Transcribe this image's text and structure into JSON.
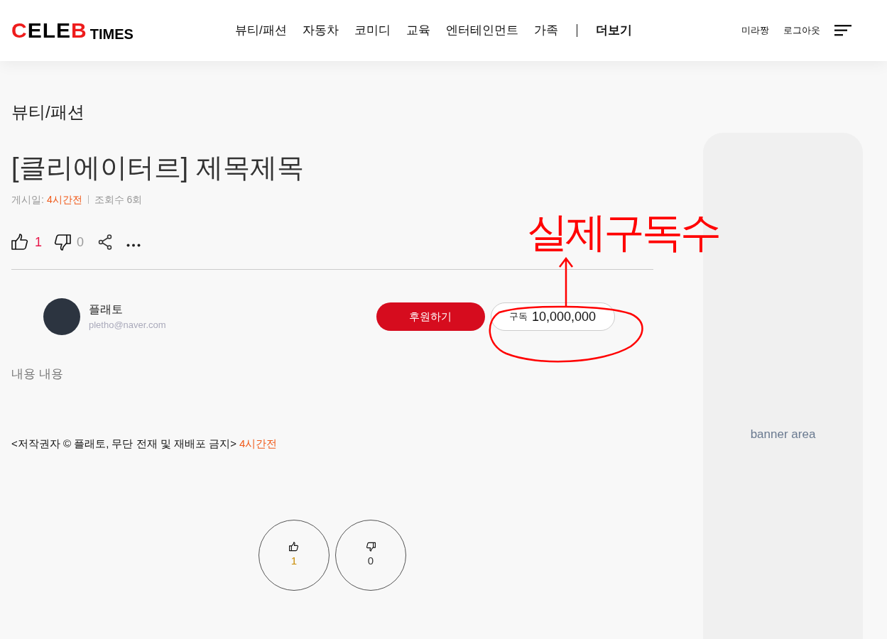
{
  "header": {
    "logo": {
      "text": "CELEB",
      "sub": "TIMES"
    },
    "nav": [
      {
        "label": "뷰티/패션",
        "kind": "link"
      },
      {
        "label": "자동차",
        "kind": "link"
      },
      {
        "label": "코미디",
        "kind": "link"
      },
      {
        "label": "교육",
        "kind": "link"
      },
      {
        "label": "엔터테인먼트",
        "kind": "link"
      },
      {
        "label": "가족",
        "kind": "link"
      },
      {
        "label": "더보기",
        "kind": "more"
      }
    ],
    "user": "미라짱",
    "logout": "로그아웃"
  },
  "category": "뷰티/패션",
  "article": {
    "title": "[클리에이터르] 제목제목",
    "meta": {
      "posted_label": "게시일:",
      "posted_time": "4시간전",
      "views": "조회수 6회"
    },
    "actions": {
      "likes": "1",
      "dislikes": "0"
    },
    "author": {
      "name": "플래토",
      "email": "pletho@naver.com"
    },
    "donate_button": "후원하기",
    "subscribe": {
      "label": "구독",
      "count": "10,000,000"
    },
    "body": "내용 내용",
    "copyright": {
      "text": "<저작권자 © 플래토, 무단 전재 및 재배포 금지>",
      "time": "4시간전"
    },
    "votes": {
      "likes": "1",
      "dislikes": "0"
    }
  },
  "banner": "banner area",
  "annotation": {
    "text": "실제구독수"
  }
}
